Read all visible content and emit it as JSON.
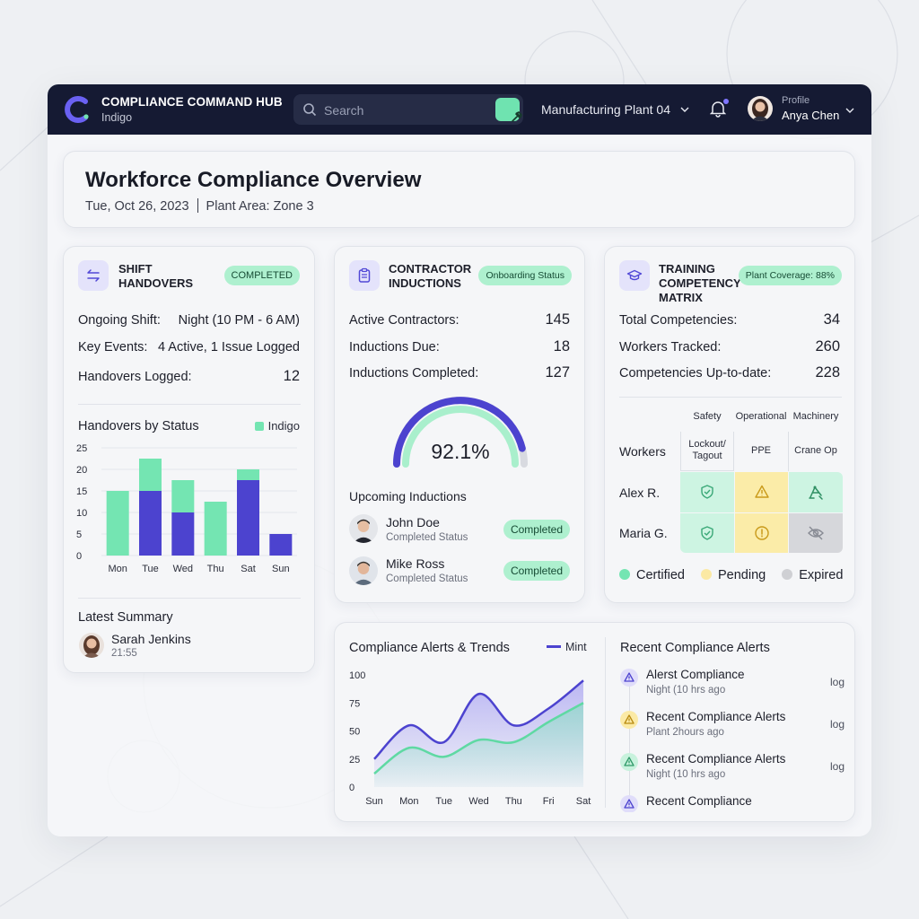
{
  "app": {
    "title": "COMPLIANCE COMMAND HUB",
    "subtitle": "Indigo"
  },
  "search": {
    "placeholder": "Search"
  },
  "plant_selector": {
    "value": "Manufacturing Plant 04"
  },
  "profile": {
    "label": "Profile",
    "name": "Anya Chen"
  },
  "header": {
    "title": "Workforce Compliance Overview",
    "date": "Tue, Oct 26, 2023",
    "area": "Plant Area: Zone 3"
  },
  "colors": {
    "indigo": "#4c43cf",
    "mint": "#74e5b2",
    "navy": "#151a33",
    "pending": "#fbe9a4",
    "expired": "#d6d7db"
  },
  "shift": {
    "title_line1": "SHIFT",
    "title_line2": "HANDOVERS",
    "badge": "COMPLETED",
    "rows": [
      {
        "label": "Ongoing Shift:",
        "value": "Night (10 PM - 6 AM)"
      },
      {
        "label": "Key Events:",
        "value": "4 Active, 1 Issue Logged"
      },
      {
        "label": "Handovers Logged:",
        "value": "12"
      }
    ],
    "chart_title": "Handovers by Status",
    "legend": "Indigo",
    "summary_title": "Latest Summary",
    "summary_name": "Sarah Jenkins",
    "summary_time": "21:55"
  },
  "contractor": {
    "title_line1": "CONTRACTOR",
    "title_line2": "INDUCTIONS",
    "badge": "Onboarding Status",
    "rows": [
      {
        "label": "Active Contractors:",
        "value": "145"
      },
      {
        "label": "Inductions Due:",
        "value": "18"
      },
      {
        "label": "Inductions Completed:",
        "value": "127"
      }
    ],
    "gauge_value": "92.1%",
    "gauge_fraction": 0.921,
    "upcoming_title": "Upcoming Inductions",
    "people": [
      {
        "name": "John Doe",
        "status": "Completed Status",
        "badge": "Completed"
      },
      {
        "name": "Mike Ross",
        "status": "Completed Status",
        "badge": "Completed"
      }
    ]
  },
  "training": {
    "title_line1": "TRAINING",
    "title_line2": "COMPETENCY",
    "title_line3": "MATRIX",
    "badge": "Plant Coverage: 88%",
    "rows": [
      {
        "label": "Total Competencies:",
        "value": "34"
      },
      {
        "label": "Workers Tracked:",
        "value": "260"
      },
      {
        "label": "Competencies Up-to-date:",
        "value": "228"
      }
    ],
    "groups": [
      "Safety",
      "Operational",
      "Machinery"
    ],
    "corner": "Workers",
    "columns": [
      "Lockout/",
      "Tagout",
      "PPE",
      "Crane Op"
    ],
    "workers": [
      "Alex R.",
      "Maria G."
    ],
    "cells": [
      [
        "certified",
        "pending",
        "certified"
      ],
      [
        "certified",
        "pending",
        "expired"
      ]
    ],
    "legend": [
      "Certified",
      "Pending",
      "Expired"
    ]
  },
  "trends": {
    "title": "Compliance Alerts & Trends",
    "legend": "Mint"
  },
  "alerts": {
    "title": "Recent Compliance Alerts",
    "items": [
      {
        "title": "Alerst Compliance",
        "sub": "Night (10 hrs ago",
        "action": "log",
        "level": "indigo"
      },
      {
        "title": "Recent Compliance Alerts",
        "sub": "Plant 2hours ago",
        "action": "log",
        "level": "yellow"
      },
      {
        "title": "Recent Compliance Alerts",
        "sub": "Night (10 hrs ago",
        "action": "log",
        "level": "mint"
      },
      {
        "title": "Recent Compliance",
        "sub": "",
        "action": "",
        "level": "indigo"
      }
    ]
  },
  "chart_data": [
    {
      "type": "bar",
      "title": "Handovers by Status",
      "categories": [
        "Mon",
        "Tue",
        "Wed",
        "Thu",
        "Sat",
        "Sun"
      ],
      "series": [
        {
          "name": "Indigo",
          "values": [
            0,
            15,
            10,
            0,
            17.5,
            5
          ]
        },
        {
          "values": [
            15,
            7.5,
            7.5,
            12.5,
            2.5,
            0
          ]
        }
      ],
      "stacked": true,
      "ylim": [
        0,
        25
      ],
      "yticks": [
        0,
        5,
        10,
        15,
        20,
        25
      ],
      "legend": "top-right"
    },
    {
      "type": "area",
      "title": "Compliance Alerts & Trends",
      "categories": [
        "Sun",
        "Mon",
        "Tue",
        "Wed",
        "Thu",
        "Fri",
        "Sat"
      ],
      "series": [
        {
          "name": "Mint",
          "values": [
            25,
            55,
            40,
            83,
            55,
            70,
            95
          ]
        },
        {
          "values": [
            12,
            35,
            27,
            42,
            40,
            58,
            75
          ]
        }
      ],
      "ylim": [
        0,
        100
      ],
      "yticks": [
        0,
        25,
        50,
        75,
        100
      ],
      "legend": "top-right"
    }
  ]
}
